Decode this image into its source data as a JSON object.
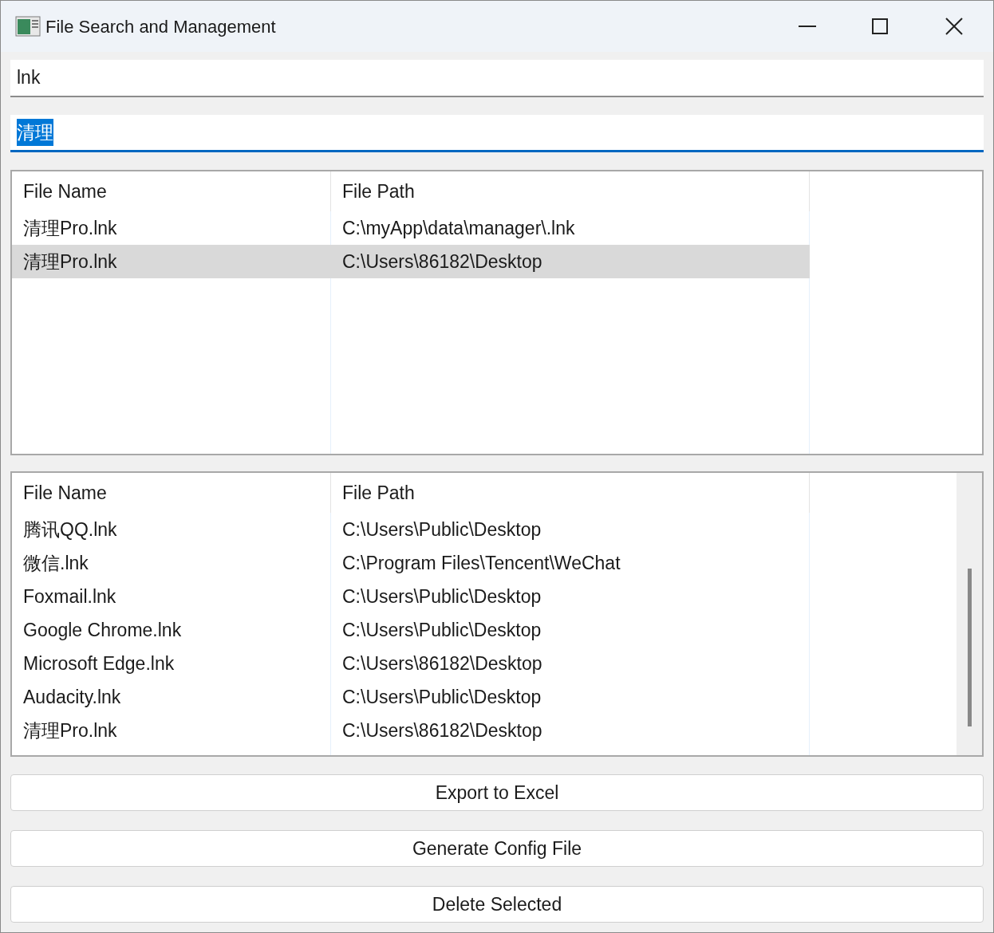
{
  "window": {
    "title": "File Search and Management"
  },
  "fields": [
    {
      "value": "lnk",
      "focused": false,
      "text_selected": false
    },
    {
      "value": "清理",
      "focused": true,
      "text_selected": true
    }
  ],
  "tables": [
    {
      "columns": [
        "File Name",
        "File Path"
      ],
      "scrollbar": false,
      "rows": [
        {
          "name": "清理Pro.lnk",
          "path": "C:\\myApp\\data\\manager\\.lnk",
          "selected": false
        },
        {
          "name": "清理Pro.lnk",
          "path": "C:\\Users\\86182\\Desktop",
          "selected": true
        }
      ]
    },
    {
      "columns": [
        "File Name",
        "File Path"
      ],
      "scrollbar": true,
      "rows": [
        {
          "name": "腾讯QQ.lnk",
          "path": "C:\\Users\\Public\\Desktop",
          "selected": false
        },
        {
          "name": "微信.lnk",
          "path": "C:\\Program Files\\Tencent\\WeChat",
          "selected": false
        },
        {
          "name": "Foxmail.lnk",
          "path": "C:\\Users\\Public\\Desktop",
          "selected": false
        },
        {
          "name": "Google Chrome.lnk",
          "path": "C:\\Users\\Public\\Desktop",
          "selected": false
        },
        {
          "name": "Microsoft Edge.lnk",
          "path": "C:\\Users\\86182\\Desktop",
          "selected": false
        },
        {
          "name": "Audacity.lnk",
          "path": "C:\\Users\\Public\\Desktop",
          "selected": false
        },
        {
          "name": "清理Pro.lnk",
          "path": "C:\\Users\\86182\\Desktop",
          "selected": false
        }
      ]
    }
  ],
  "buttons": [
    "Export to Excel",
    "Generate Config File",
    "Delete Selected"
  ]
}
